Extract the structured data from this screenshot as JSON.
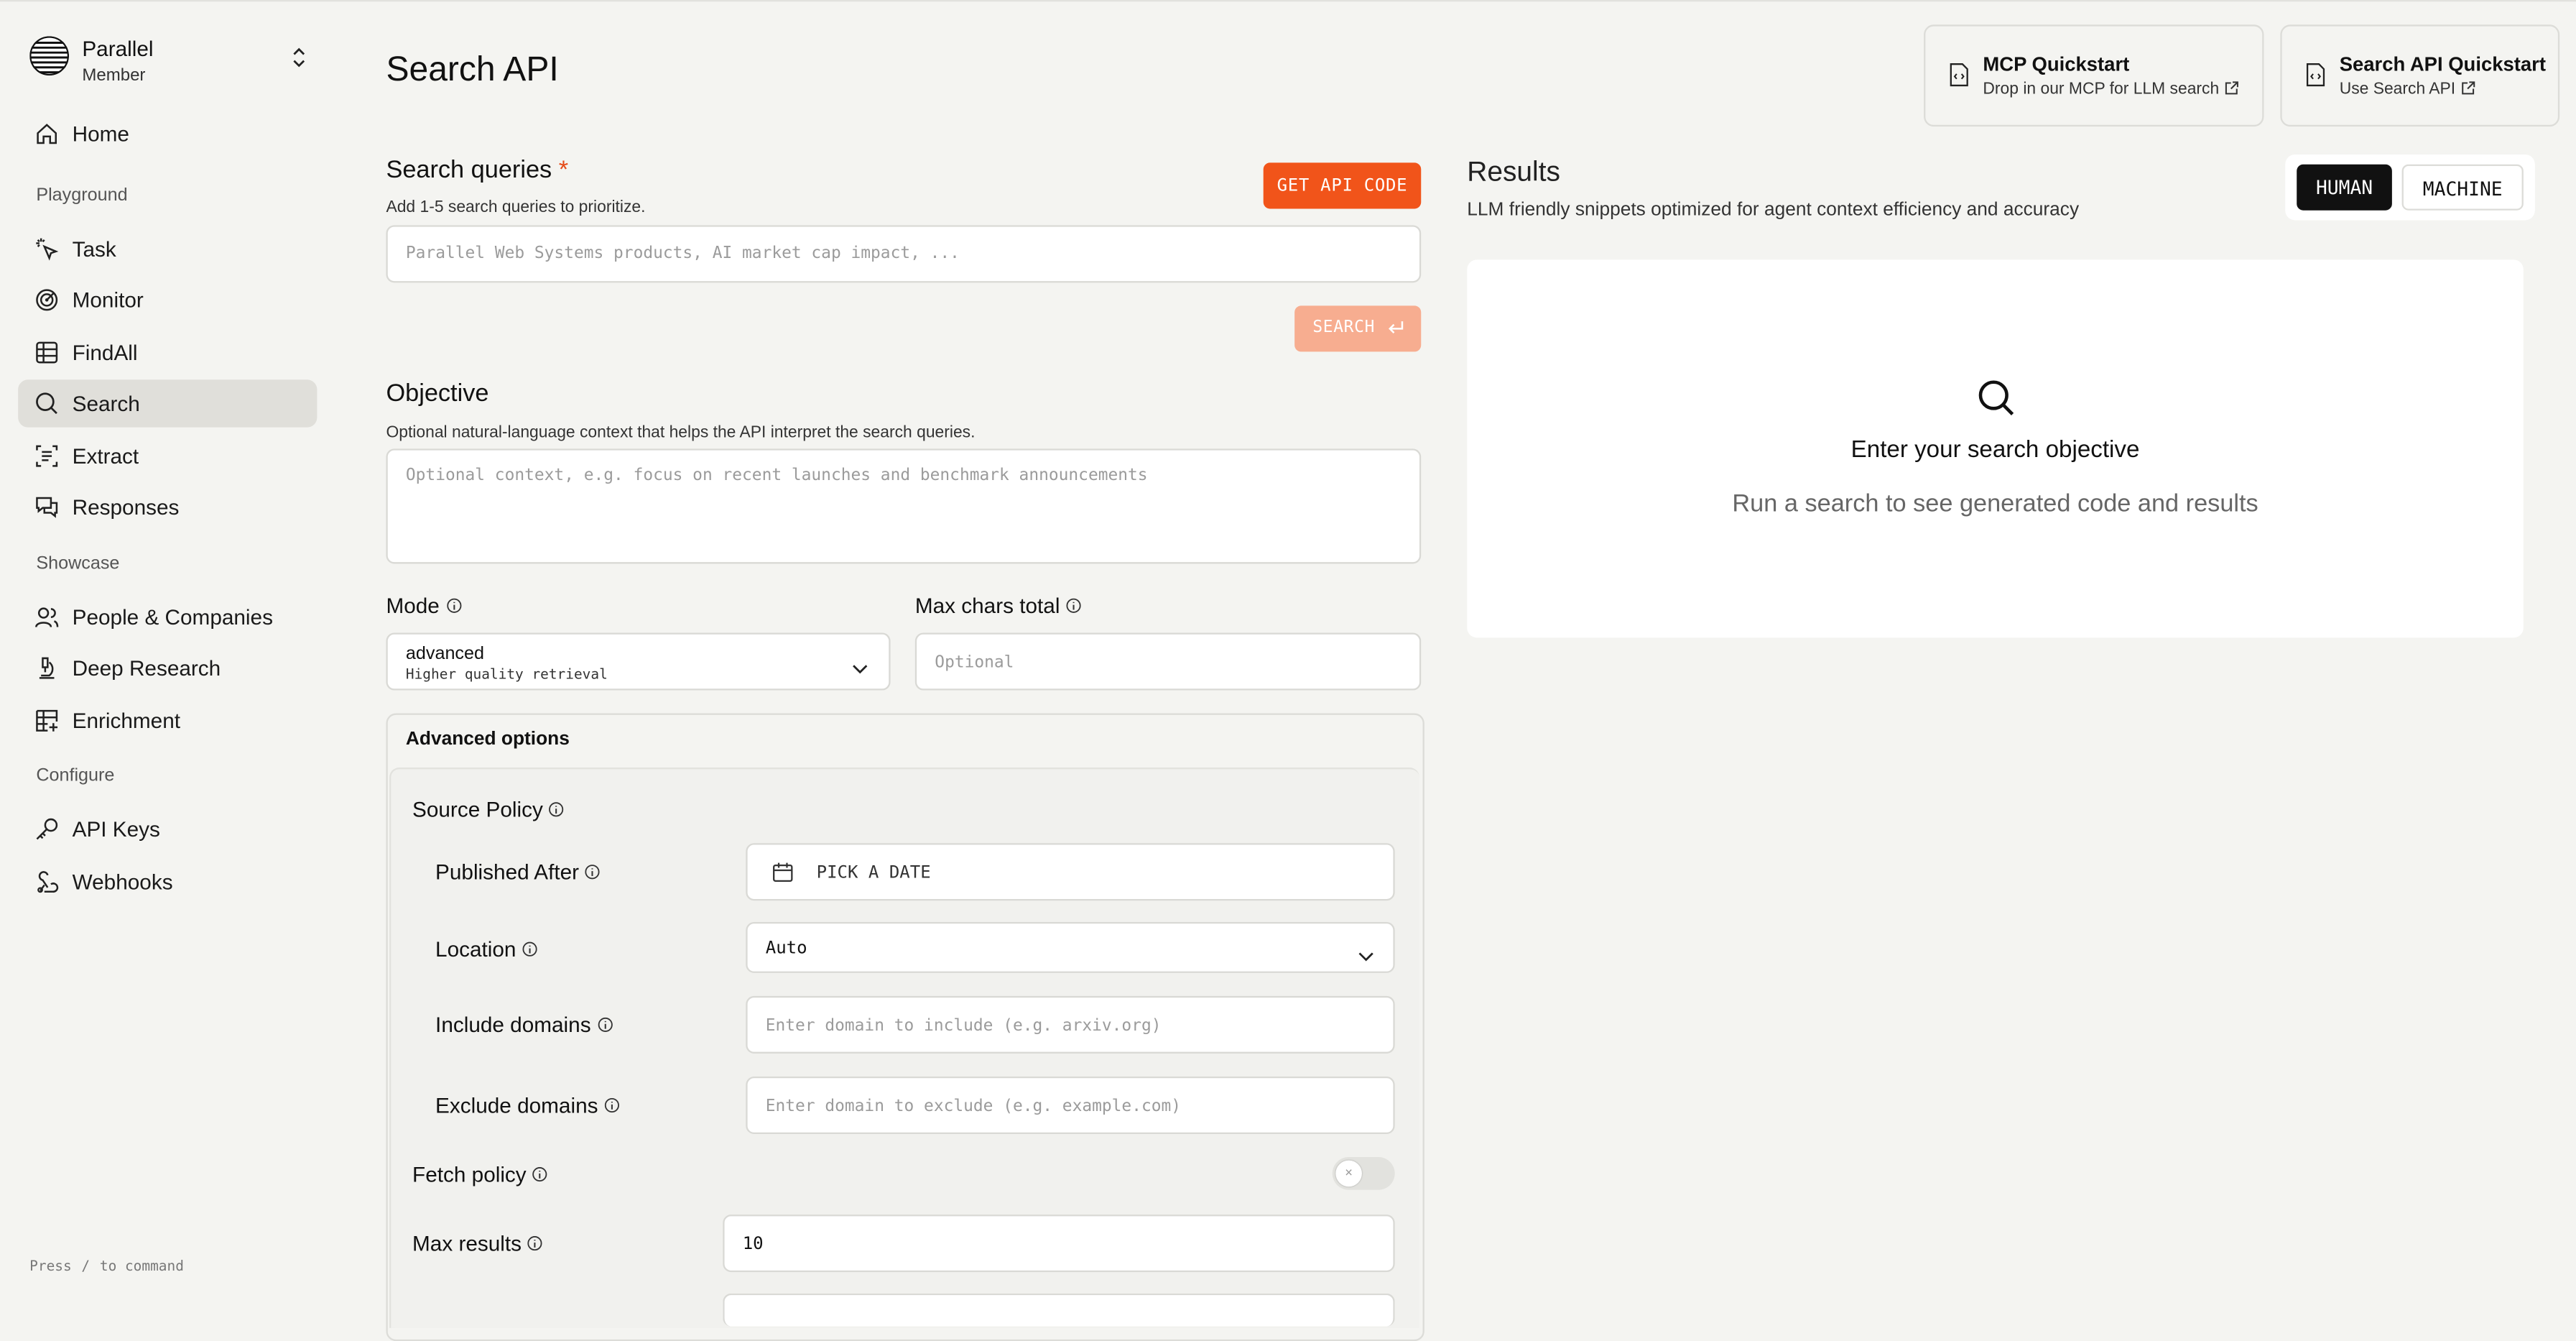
{
  "sidebar": {
    "org_name": "Parallel",
    "org_role": "Member",
    "home": "Home",
    "sections": {
      "playground": "Playground",
      "showcase": "Showcase",
      "configure": "Configure"
    },
    "items": [
      {
        "label": "Task",
        "icon": "cursor-click-icon"
      },
      {
        "label": "Monitor",
        "icon": "radar-icon"
      },
      {
        "label": "FindAll",
        "icon": "table-icon"
      },
      {
        "label": "Search",
        "icon": "search-icon",
        "active": true
      },
      {
        "label": "Extract",
        "icon": "scan-icon"
      },
      {
        "label": "Responses",
        "icon": "chat-icon"
      },
      {
        "label": "People & Companies",
        "icon": "users-icon"
      },
      {
        "label": "Deep Research",
        "icon": "microscope-icon"
      },
      {
        "label": "Enrichment",
        "icon": "grid-plus-icon"
      },
      {
        "label": "API Keys",
        "icon": "key-icon"
      },
      {
        "label": "Webhooks",
        "icon": "webhook-icon"
      }
    ],
    "press_hint": {
      "pre": "Press",
      "key": "/",
      "post": "to command"
    }
  },
  "header": {
    "title": "Search API",
    "quickstarts": [
      {
        "title": "MCP Quickstart",
        "subtitle": "Drop in our MCP for LLM search"
      },
      {
        "title": "Search API Quickstart",
        "subtitle": "Use Search API"
      }
    ]
  },
  "form": {
    "queries": {
      "title": "Search queries",
      "required_mark": "*",
      "subtitle": "Add 1-5 search queries to prioritize.",
      "placeholder": "Parallel Web Systems products, AI market cap impact, ...",
      "get_code": "GET API CODE",
      "search": "SEARCH"
    },
    "objective": {
      "title": "Objective",
      "subtitle": "Optional natural-language context that helps the API interpret the search queries.",
      "placeholder": "Optional context, e.g. focus on recent launches and benchmark announcements"
    },
    "mode": {
      "label": "Mode",
      "value": "advanced",
      "description": "Higher quality retrieval"
    },
    "max_chars": {
      "label": "Max chars total",
      "placeholder": "Optional"
    },
    "advanced": {
      "title": "Advanced options",
      "source_policy": "Source Policy",
      "published_after": {
        "label": "Published After",
        "value": "PICK A DATE"
      },
      "location": {
        "label": "Location",
        "value": "Auto"
      },
      "include_domains": {
        "label": "Include domains",
        "placeholder": "Enter domain to include (e.g. arxiv.org)"
      },
      "exclude_domains": {
        "label": "Exclude domains",
        "placeholder": "Enter domain to exclude (e.g. example.com)"
      },
      "fetch_policy": {
        "label": "Fetch policy",
        "enabled": false
      },
      "max_results": {
        "label": "Max results",
        "value": "10"
      }
    }
  },
  "results": {
    "title": "Results",
    "subtitle": "LLM friendly snippets optimized for agent context efficiency and accuracy",
    "view_modes": {
      "human": "HUMAN",
      "machine": "MACHINE",
      "selected": "HUMAN"
    },
    "empty_title": "Enter your search objective",
    "empty_text": "Run a search to see generated code and results"
  },
  "colors": {
    "accent": "#f1541a",
    "accent_disabled": "#f7ad90",
    "background": "#f4f4f1",
    "active_nav": "#e0dfda"
  }
}
